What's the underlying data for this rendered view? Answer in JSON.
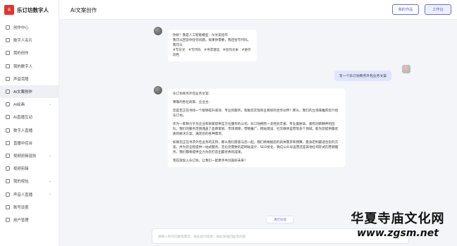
{
  "brand": {
    "logo_text": "乐",
    "name": "乐订坊数字人"
  },
  "header": {
    "title": "Ai文案创作",
    "btn_secondary": "我的作品",
    "btn_primary": "工作台"
  },
  "sidebar": {
    "items": [
      {
        "label": "创作中心",
        "expandable": false
      },
      {
        "label": "数字人名片",
        "expandable": false
      },
      {
        "label": "我的创作",
        "expandable": false
      },
      {
        "label": "我的数字人",
        "expandable": false
      },
      {
        "label": "声音克隆",
        "expandable": false
      },
      {
        "label": "Ai文案创作",
        "expandable": false,
        "active": true
      },
      {
        "label": "Ai绘画",
        "expandable": true
      },
      {
        "label": "Ai直播互动",
        "expandable": false
      },
      {
        "label": "数字人直播",
        "expandable": false
      },
      {
        "label": "直播中控台",
        "expandable": false
      },
      {
        "label": "视频剪辑混剪",
        "expandable": true
      },
      {
        "label": "视频剪辑",
        "expandable": false
      },
      {
        "label": "我的视包",
        "expandable": true
      },
      {
        "label": "声音人直播",
        "expandable": true
      },
      {
        "label": "账号设置",
        "expandable": false
      },
      {
        "label": "用户管理",
        "expandable": false
      }
    ]
  },
  "chat": {
    "greeting": {
      "lines": [
        "你好！我是人工智能模型 - Ai文案创作",
        "我可以回答你任何问题。如果你需要，我还会写代码。",
        "我可以"
      ],
      "tags": [
        "#写论文",
        "#写代码",
        "#寻求建议",
        "#创作文本",
        "#进行润色"
      ]
    },
    "user_message": "写一个乐订坊商务外包业务文案",
    "reply": {
      "paragraphs": [
        "乐订坊商务外包业务文案：",
        "尊敬的各位商家、企业主：",
        "您是否正在寻找一个能够提升高效、专业的服务，帮助您实现商业目标的合作伙伴？那么，我们的立场来推荐您介绍乐订坊。",
        "作为一家致力于为企业和商家提供全方位服务的公司，乐订坊拥有一支经验丰富、专业素质高、富有创新精神的团队。我们的服务范围涵盖了品牌策划、市场调研、营销推广、网站建设、社交媒体运营等多个领域，能为您提供最优质的解决方案，满足您的各种需求。",
        "如果您正在寻求外包业务的支持，那么我们愿意与您一起。我们将根据您的具体需求和预算，量身定制最适合您的方案，并为您全程提供一站式服务。无论您需要的是网站设计、SEO优化、微信公众号运营还是其他任何形式的营销服务，我们都将提供全力为您打造出最优秀的成果。",
        "现在就加入乐订坊，让我们一起携手共创美好未来！"
      ]
    },
    "clear_label": "清空对话",
    "input_placeholder": "请输入你的问题或需求，按此提问或者，按此发送回复或问题",
    "send_icon": "send-icon"
  },
  "watermark": {
    "line1": "华夏寺庙文化网",
    "line2": "www.zgsm.net"
  }
}
